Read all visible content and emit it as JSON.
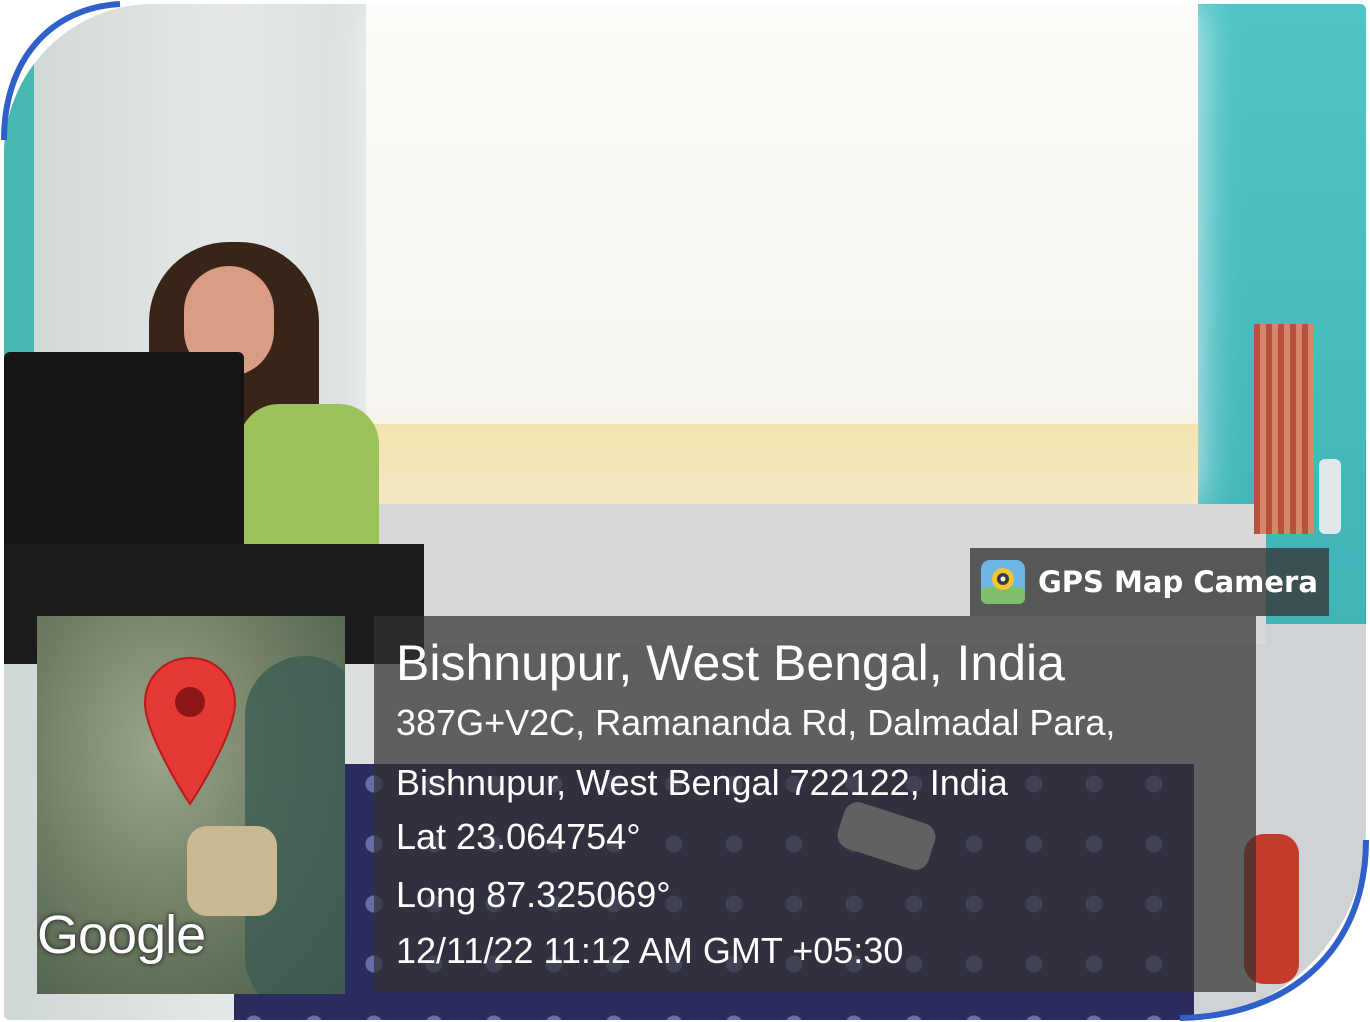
{
  "badge": {
    "label": "GPS Map Camera",
    "icon": "gps-map-camera-icon"
  },
  "map": {
    "provider": "Google",
    "pin_icon": "map-pin-icon",
    "pin_color": "#e53935"
  },
  "location": {
    "title": "Bishnupur, West Bengal, India",
    "address_line1": "387G+V2C, Ramananda Rd, Dalmadal Para,",
    "address_line2": "Bishnupur, West Bengal 722122, India",
    "latitude": "Lat 23.064754°",
    "longitude": "Long 87.325069°",
    "timestamp": "12/11/22 11:12 AM GMT +05:30"
  },
  "colors": {
    "overlay": "#323232",
    "frame_accent": "#2f5fc9"
  }
}
